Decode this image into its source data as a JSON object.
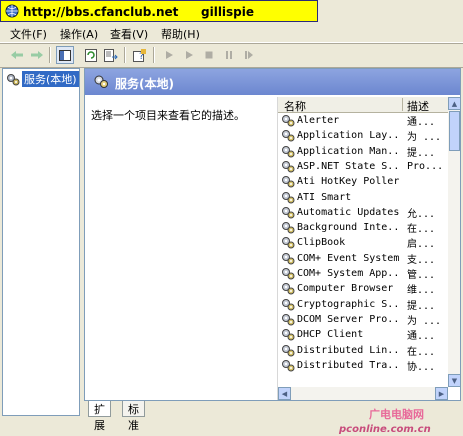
{
  "banner": {
    "url": "http://bbs.cfanclub.net",
    "user": "gillispie"
  },
  "menu": {
    "items": [
      "文件(F)",
      "操作(A)",
      "查看(V)",
      "帮助(H)"
    ]
  },
  "toolbar": {
    "buttons": [
      "back-arrow-icon",
      "forward-arrow-icon",
      "show-hide-tree-icon",
      "refresh-icon",
      "export-list-icon",
      "properties-help-icon",
      "start-service-icon",
      "play-icon",
      "stop-icon",
      "pause-icon",
      "restart-icon"
    ]
  },
  "tree": {
    "root_label": "服务(本地)"
  },
  "panel": {
    "title": "服务(本地)",
    "description_prompt": "选择一个项目来查看它的描述。"
  },
  "list": {
    "columns": [
      "名称",
      "描述"
    ],
    "rows": [
      {
        "name": "Alerter",
        "desc": "通..."
      },
      {
        "name": "Application Lay...",
        "desc": "为 ..."
      },
      {
        "name": "Application Man...",
        "desc": "提..."
      },
      {
        "name": "ASP.NET State S...",
        "desc": "Pro..."
      },
      {
        "name": "Ati HotKey Poller",
        "desc": ""
      },
      {
        "name": "ATI Smart",
        "desc": ""
      },
      {
        "name": "Automatic Updates",
        "desc": "允..."
      },
      {
        "name": "Background Inte...",
        "desc": "在..."
      },
      {
        "name": "ClipBook",
        "desc": "启..."
      },
      {
        "name": "COM+ Event System",
        "desc": "支..."
      },
      {
        "name": "COM+ System App...",
        "desc": "管..."
      },
      {
        "name": "Computer Browser",
        "desc": "维..."
      },
      {
        "name": "Cryptographic S...",
        "desc": "提..."
      },
      {
        "name": "DCOM Server Pro...",
        "desc": "为 ..."
      },
      {
        "name": "DHCP Client",
        "desc": "通..."
      },
      {
        "name": "Distributed Lin...",
        "desc": "在..."
      },
      {
        "name": "Distributed Tra...",
        "desc": "协..."
      }
    ]
  },
  "tabs": [
    "扩展",
    "标准"
  ],
  "watermark": {
    "text": "广电电脑网 pconline.com.cn"
  }
}
